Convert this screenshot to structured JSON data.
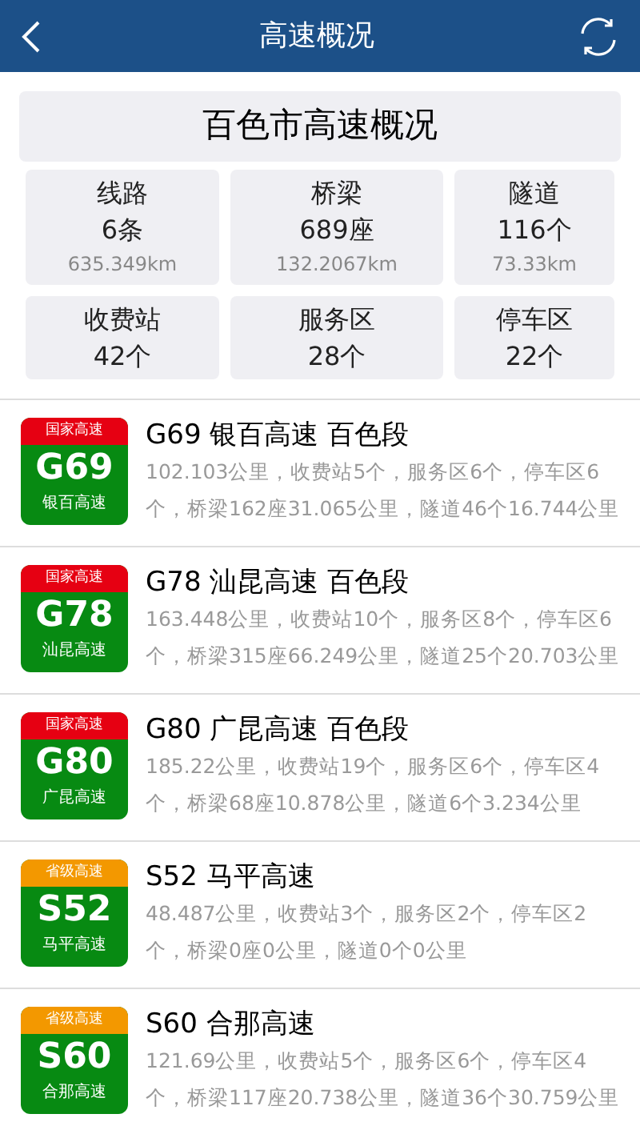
{
  "header": {
    "title": "高速概况"
  },
  "summary": {
    "title": "百色市高速概况",
    "stats": [
      {
        "label": "线路",
        "value": "6条",
        "detail": "635.349km"
      },
      {
        "label": "桥梁",
        "value": "689座",
        "detail": "132.2067km"
      },
      {
        "label": "隧道",
        "value": "116个",
        "detail": "73.33km"
      },
      {
        "label": "收费站",
        "value": "42个"
      },
      {
        "label": "服务区",
        "value": "28个"
      },
      {
        "label": "停车区",
        "value": "22个"
      }
    ]
  },
  "highways": [
    {
      "badge_type": "国家高速",
      "color": "#e60012",
      "code": "G69",
      "badge_name": "银百高速",
      "title": "G69 银百高速 百色段",
      "description": "102.103公里，收费站5个，服务区6个，停车区6个，桥梁162座31.065公里，隧道46个16.744公里"
    },
    {
      "badge_type": "国家高速",
      "color": "#e60012",
      "code": "G78",
      "badge_name": "汕昆高速",
      "title": "G78 汕昆高速 百色段",
      "description": "163.448公里，收费站10个，服务区8个，停车区6个，桥梁315座66.249公里，隧道25个20.703公里"
    },
    {
      "badge_type": "国家高速",
      "color": "#e60012",
      "code": "G80",
      "badge_name": "广昆高速",
      "title": "G80 广昆高速 百色段",
      "description": "185.22公里，收费站19个，服务区6个，停车区4个，桥梁68座10.878公里，隧道6个3.234公里"
    },
    {
      "badge_type": "省级高速",
      "color": "#f39800",
      "code": "S52",
      "badge_name": "马平高速",
      "title": "S52 马平高速",
      "description": "48.487公里，收费站3个，服务区2个，停车区2个，桥梁0座0公里，隧道0个0公里"
    },
    {
      "badge_type": "省级高速",
      "color": "#f39800",
      "code": "S60",
      "badge_name": "合那高速",
      "title": "S60 合那高速",
      "description": "121.69公里，收费站5个，服务区6个，停车区4个，桥梁117座20.738公里，隧道36个30.759公里"
    }
  ]
}
